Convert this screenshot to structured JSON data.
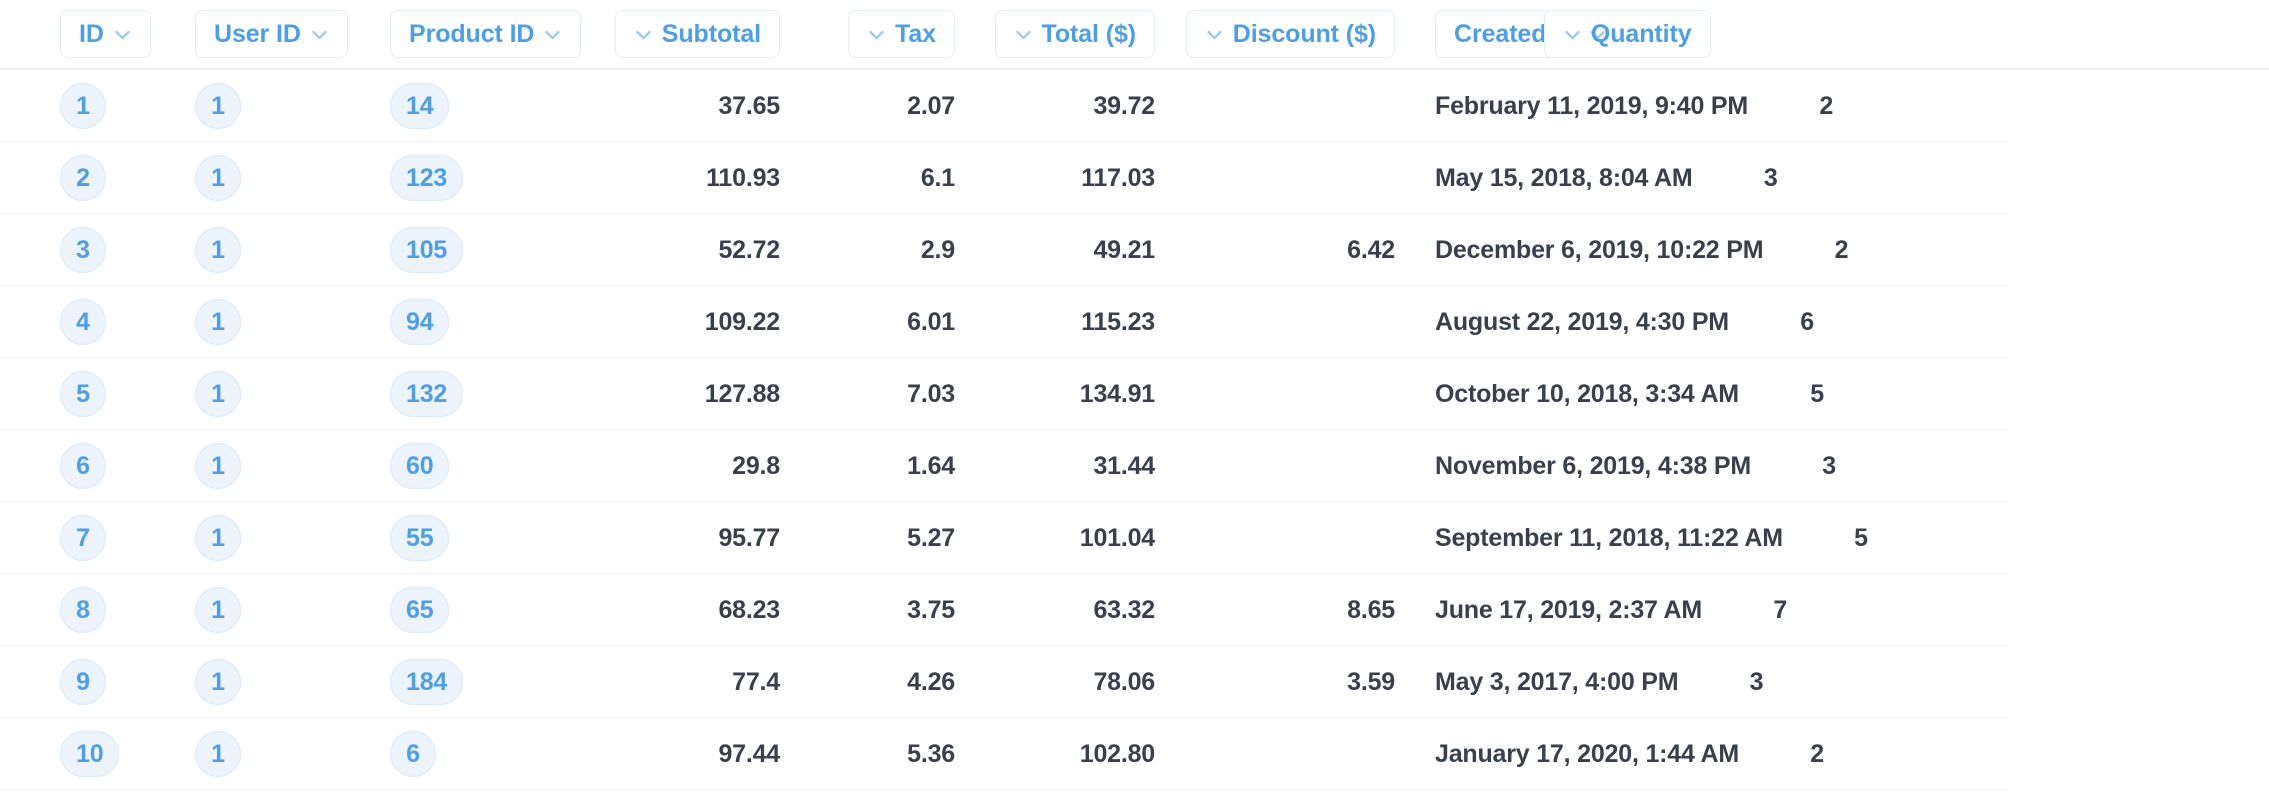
{
  "table": {
    "columns": [
      {
        "key": "id",
        "label": "ID",
        "align": "left",
        "chevron": "right",
        "cell_type": "pill"
      },
      {
        "key": "user_id",
        "label": "User ID",
        "align": "left",
        "chevron": "right",
        "cell_type": "pill"
      },
      {
        "key": "product_id",
        "label": "Product ID",
        "align": "left",
        "chevron": "right",
        "cell_type": "pill"
      },
      {
        "key": "subtotal",
        "label": "Subtotal",
        "align": "right",
        "chevron": "left",
        "cell_type": "text"
      },
      {
        "key": "tax",
        "label": "Tax",
        "align": "right",
        "chevron": "left",
        "cell_type": "text"
      },
      {
        "key": "total",
        "label": "Total ($)",
        "align": "right",
        "chevron": "left",
        "cell_type": "text"
      },
      {
        "key": "discount",
        "label": "Discount ($)",
        "align": "right",
        "chevron": "left",
        "cell_type": "text"
      },
      {
        "key": "created_at",
        "label": "Created At",
        "align": "left",
        "chevron": "right",
        "cell_type": "text"
      },
      {
        "key": "quantity",
        "label": "Quantity",
        "align": "right",
        "chevron": "left",
        "cell_type": "text"
      }
    ],
    "icons": {
      "sort_chevron": "chevron-down-icon"
    },
    "colors": {
      "header_text": "#4C9EE8",
      "cell_text": "#393F4B",
      "pill_background": "#EDF3FB",
      "pill_border": "#DCE9F8",
      "pill_text": "#4C9EE8",
      "row_divider": "#F2F3F5",
      "header_divider": "#EDF0F2",
      "chip_border": "#E3EBF3",
      "background": "#FFFFFF"
    },
    "rows": [
      {
        "id": "1",
        "user_id": "1",
        "product_id": "14",
        "subtotal": "37.65",
        "tax": "2.07",
        "total": "39.72",
        "discount": "",
        "created_at": "February 11, 2019, 9:40 PM",
        "quantity": "2"
      },
      {
        "id": "2",
        "user_id": "1",
        "product_id": "123",
        "subtotal": "110.93",
        "tax": "6.1",
        "total": "117.03",
        "discount": "",
        "created_at": "May 15, 2018, 8:04 AM",
        "quantity": "3"
      },
      {
        "id": "3",
        "user_id": "1",
        "product_id": "105",
        "subtotal": "52.72",
        "tax": "2.9",
        "total": "49.21",
        "discount": "6.42",
        "created_at": "December 6, 2019, 10:22 PM",
        "quantity": "2"
      },
      {
        "id": "4",
        "user_id": "1",
        "product_id": "94",
        "subtotal": "109.22",
        "tax": "6.01",
        "total": "115.23",
        "discount": "",
        "created_at": "August 22, 2019, 4:30 PM",
        "quantity": "6"
      },
      {
        "id": "5",
        "user_id": "1",
        "product_id": "132",
        "subtotal": "127.88",
        "tax": "7.03",
        "total": "134.91",
        "discount": "",
        "created_at": "October 10, 2018, 3:34 AM",
        "quantity": "5"
      },
      {
        "id": "6",
        "user_id": "1",
        "product_id": "60",
        "subtotal": "29.8",
        "tax": "1.64",
        "total": "31.44",
        "discount": "",
        "created_at": "November 6, 2019, 4:38 PM",
        "quantity": "3"
      },
      {
        "id": "7",
        "user_id": "1",
        "product_id": "55",
        "subtotal": "95.77",
        "tax": "5.27",
        "total": "101.04",
        "discount": "",
        "created_at": "September 11, 2018, 11:22 AM",
        "quantity": "5"
      },
      {
        "id": "8",
        "user_id": "1",
        "product_id": "65",
        "subtotal": "68.23",
        "tax": "3.75",
        "total": "63.32",
        "discount": "8.65",
        "created_at": "June 17, 2019, 2:37 AM",
        "quantity": "7"
      },
      {
        "id": "9",
        "user_id": "1",
        "product_id": "184",
        "subtotal": "77.4",
        "tax": "4.26",
        "total": "78.06",
        "discount": "3.59",
        "created_at": "May 3, 2017, 4:00 PM",
        "quantity": "3"
      },
      {
        "id": "10",
        "user_id": "1",
        "product_id": "6",
        "subtotal": "97.44",
        "tax": "5.36",
        "total": "102.80",
        "discount": "",
        "created_at": "January 17, 2020, 1:44 AM",
        "quantity": "2"
      }
    ]
  }
}
